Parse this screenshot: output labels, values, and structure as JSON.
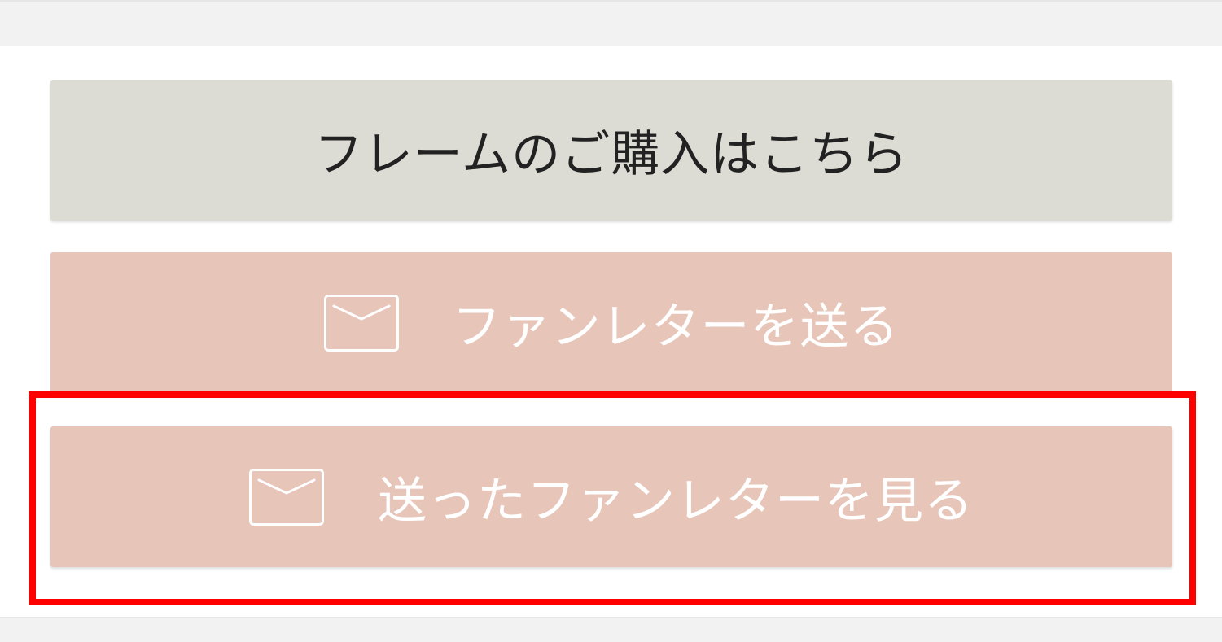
{
  "buttons": {
    "frame_purchase": {
      "label": "フレームのご購入はこちら"
    },
    "send_fan_letter": {
      "label": "ファンレターを送る",
      "icon": "envelope-icon"
    },
    "view_sent_fan_letters": {
      "label": "送ったファンレターを見る",
      "icon": "envelope-icon"
    }
  },
  "colors": {
    "frame_button_bg": "#dcdcd5",
    "letter_button_bg": "#e7c5b8",
    "highlight_border": "#ff0000",
    "band_bg": "#f2f2f2"
  },
  "highlight": {
    "target": "view_sent_fan_letters"
  }
}
